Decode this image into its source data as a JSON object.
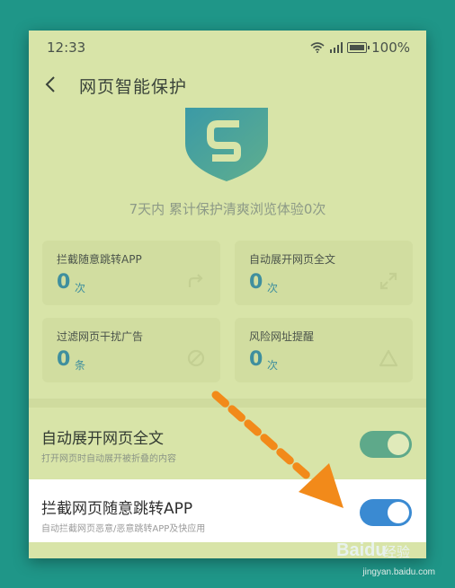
{
  "status": {
    "time": "12:33",
    "battery": "100%"
  },
  "header": {
    "title": "网页智能保护"
  },
  "summary": "7天内 累计保护清爽浏览体验0次",
  "cards": [
    {
      "label": "拦截随意跳转APP",
      "value": "0",
      "unit": "次",
      "icon": "redirect-arrow-icon"
    },
    {
      "label": "自动展开网页全文",
      "value": "0",
      "unit": "次",
      "icon": "expand-icon"
    },
    {
      "label": "过滤网页干扰广告",
      "value": "0",
      "unit": "条",
      "icon": "block-icon"
    },
    {
      "label": "风险网址提醒",
      "value": "0",
      "unit": "次",
      "icon": "warning-triangle-icon"
    }
  ],
  "settings": [
    {
      "title": "自动展开网页全文",
      "subtitle": "打开网页时自动展开被折叠的内容",
      "enabled": true
    },
    {
      "title": "拦截网页随意跳转APP",
      "subtitle": "自动拦截网页恶意/恶意跳转APP及快应用",
      "enabled": true
    }
  ],
  "watermark": {
    "brand": "Baidu",
    "jingyan": "经验",
    "url": "jingyan.baidu.com"
  },
  "colors": {
    "accent": "#3f8f9e",
    "toggle_on": "#3a8ad2",
    "arrow": "#f28a1a"
  }
}
